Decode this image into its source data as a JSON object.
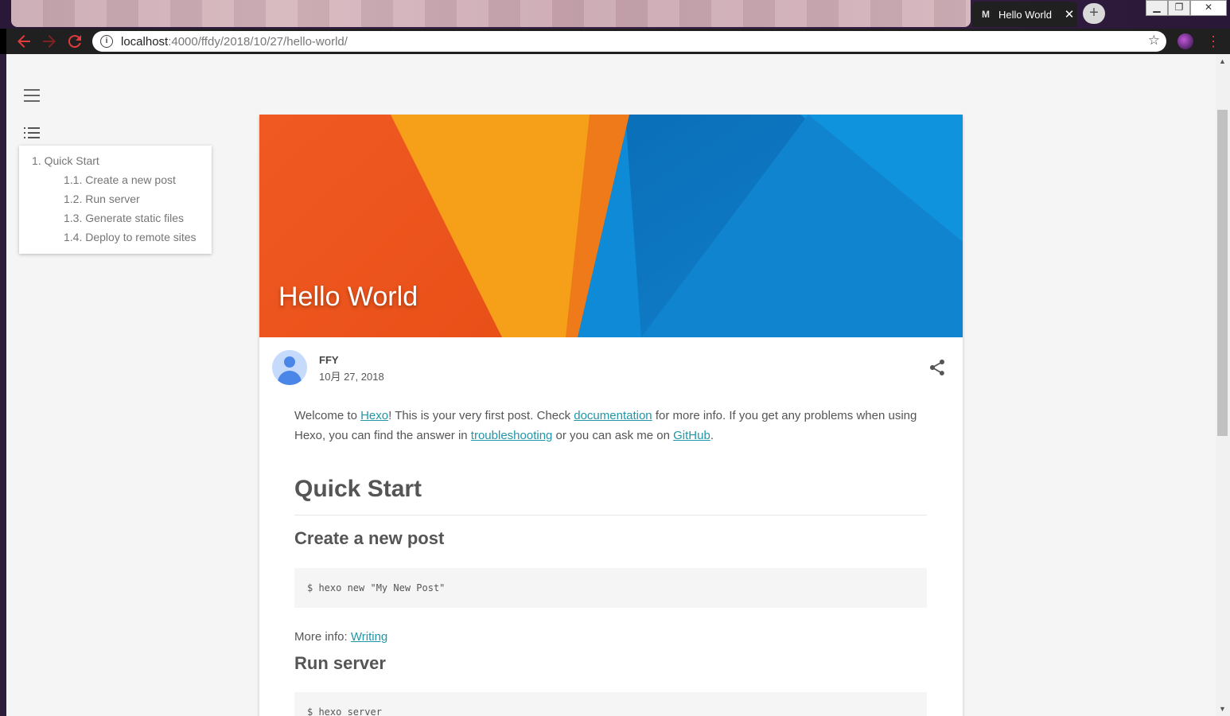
{
  "browser": {
    "active_tab": {
      "favicon": "M",
      "title": "Hello World",
      "close": "✕"
    },
    "new_tab": "+",
    "url": {
      "host": "localhost",
      "path": ":4000/ffdy/2018/10/27/hello-world/"
    },
    "window_controls": {
      "minimize": "▁",
      "restore": "❐",
      "close": "✕"
    }
  },
  "sidebar": {
    "toc": [
      {
        "number": "1.",
        "label": "Quick Start"
      },
      {
        "number": "1.1.",
        "label": "Create a new post"
      },
      {
        "number": "1.2.",
        "label": "Run server"
      },
      {
        "number": "1.3.",
        "label": "Generate static files"
      },
      {
        "number": "1.4.",
        "label": "Deploy to remote sites"
      }
    ]
  },
  "post": {
    "title": "Hello World",
    "author": "FFY",
    "date": "10月 27, 2018",
    "intro": {
      "t1": "Welcome to ",
      "link1": "Hexo",
      "t2": "! This is your very first post. Check ",
      "link2": "documentation",
      "t3": " for more info. If you get any problems when using Hexo, you can find the answer in ",
      "link3": "troubleshooting",
      "t4": " or you can ask me on ",
      "link4": "GitHub",
      "t5": "."
    },
    "h1": "Quick Start",
    "sections": [
      {
        "heading": "Create a new post",
        "code": "$ hexo new \"My New Post\"",
        "more_label": "More info: ",
        "more_link": "Writing"
      },
      {
        "heading": "Run server",
        "code": "$ hexo server"
      }
    ]
  },
  "colors": {
    "accent_link": "#2196a8",
    "hero_orange": "#f05a22",
    "hero_yellow": "#f6a019",
    "hero_blue": "#0e8ad6"
  },
  "icons": [
    "info-icon",
    "star-icon",
    "back-arrow-icon",
    "forward-arrow-icon",
    "reload-icon",
    "menu-icon",
    "toc-list-icon",
    "share-icon",
    "avatar-icon"
  ]
}
